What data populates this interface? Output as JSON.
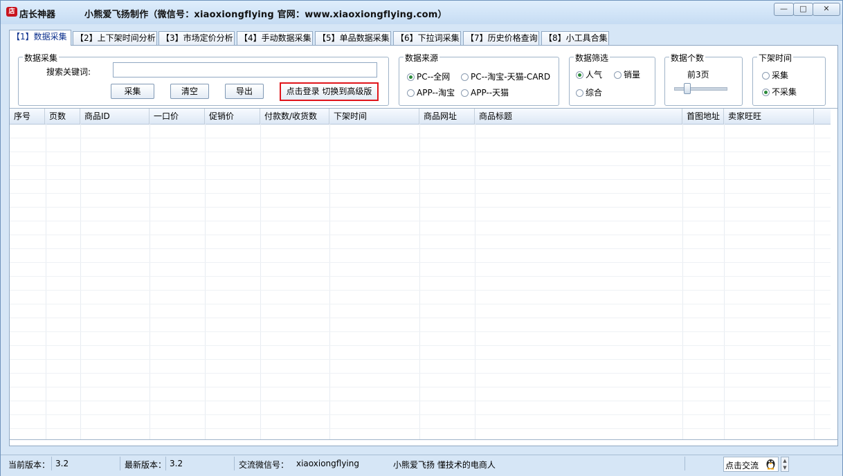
{
  "titlebar": {
    "app_icon": "店",
    "app_title": "店长神器",
    "credit": "小熊爱飞扬制作（微信号：xiaoxiongflying  官网：www.xiaoxiongflying.com）",
    "min": "—",
    "max": "□",
    "close": "✕"
  },
  "tabs": [
    {
      "label": "【1】数据采集"
    },
    {
      "label": "【2】上下架时间分析"
    },
    {
      "label": "【3】市场定价分析"
    },
    {
      "label": "【4】手动数据采集"
    },
    {
      "label": "【5】单品数据采集"
    },
    {
      "label": "【6】下拉词采集"
    },
    {
      "label": "【7】历史价格查询"
    },
    {
      "label": "【8】小工具合集"
    }
  ],
  "collect": {
    "legend": "数据采集",
    "keyword_label": "搜索关键词:",
    "keyword_value": "",
    "collect_btn": "采集",
    "clear_btn": "清空",
    "export_btn": "导出",
    "login_btn": "点击登录 切换到高级版"
  },
  "source": {
    "legend": "数据来源",
    "opt1": "PC--全网",
    "opt2": "PC--淘宝-天猫-CARD",
    "opt3": "APP--淘宝",
    "opt4": "APP--天猫",
    "selected": "PC--全网"
  },
  "filter": {
    "legend": "数据筛选",
    "opt1": "人气",
    "opt2": "销量",
    "opt3": "综合",
    "selected": "人气"
  },
  "count": {
    "legend": "数据个数",
    "value": "前3页",
    "slider_level_pages": 3
  },
  "offshelf": {
    "legend": "下架时间",
    "opt1": "采集",
    "opt2": "不采集",
    "selected": "不采集"
  },
  "table": {
    "columns": [
      "序号",
      "页数",
      "商品ID",
      "一口价",
      "促销价",
      "付款数/收货数",
      "下架时间",
      "商品网址",
      "商品标题",
      "首图地址",
      "卖家旺旺"
    ],
    "rows": []
  },
  "status": {
    "cur_label": "当前版本：",
    "cur_value": "3.2",
    "new_label": "最新版本：",
    "new_value": "3.2",
    "wx_label": "交流微信号：",
    "wx_value": "xiaoxiongflying",
    "slogan": "小熊爱飞扬  懂技术的电商人",
    "chat_btn": "点击交流"
  },
  "colors": {
    "highlight_border": "#e0141a",
    "radio_dot": "#2a8a3a",
    "active_tab_text": "#0a2f8c"
  }
}
